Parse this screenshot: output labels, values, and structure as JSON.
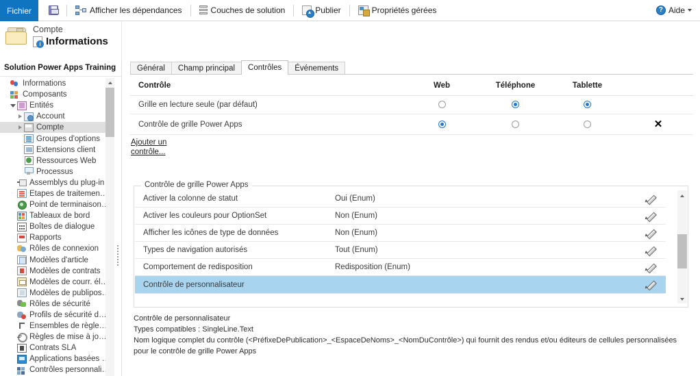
{
  "ribbon": {
    "file_tab": "Fichier",
    "items": [
      {
        "label": "",
        "icon": "save-icon",
        "name": "save-button"
      },
      {
        "label": "Afficher les dépendances",
        "icon": "dependencies-icon",
        "name": "show-dependencies-button"
      },
      {
        "label": "Couches de solution",
        "icon": "solution-layers-icon",
        "name": "solution-layers-button"
      },
      {
        "label": "Publier",
        "icon": "publish-icon",
        "name": "publish-button"
      },
      {
        "label": "Propriétés gérées",
        "icon": "managed-properties-icon",
        "name": "managed-properties-button"
      }
    ],
    "help_label": "Aide"
  },
  "header": {
    "entity_label": "Compte",
    "page_title": "Informations"
  },
  "sidebar": {
    "solution_title": "Solution Power Apps Training",
    "items": [
      {
        "label": "Informations",
        "icon": "balloons-icon",
        "indent": 0,
        "twist": "none",
        "selected": false
      },
      {
        "label": "Composants",
        "icon": "components-icon",
        "indent": 0,
        "twist": "none",
        "selected": false
      },
      {
        "label": "Entités",
        "icon": "entities-icon",
        "indent": 1,
        "twist": "open",
        "selected": false
      },
      {
        "label": "Account",
        "icon": "account-icon",
        "indent": 2,
        "twist": "closed",
        "selected": false
      },
      {
        "label": "Compte",
        "icon": "compte-icon",
        "indent": 2,
        "twist": "closed",
        "selected": true
      },
      {
        "label": "Groupes d'options",
        "icon": "option-sets-icon",
        "indent": 2,
        "twist": "none",
        "selected": false
      },
      {
        "label": "Extensions client",
        "icon": "client-extensions-icon",
        "indent": 2,
        "twist": "none",
        "selected": false
      },
      {
        "label": "Ressources Web",
        "icon": "web-resources-icon",
        "indent": 2,
        "twist": "none",
        "selected": false
      },
      {
        "label": "Processus",
        "icon": "processes-icon",
        "indent": 2,
        "twist": "none",
        "selected": false
      },
      {
        "label": "Assemblys du plug-in",
        "icon": "plugin-assemblies-icon",
        "indent": 1,
        "twist": "none",
        "selected": false
      },
      {
        "label": "Étapes de traitement d...",
        "icon": "sdk-steps-icon",
        "indent": 1,
        "twist": "none",
        "selected": false
      },
      {
        "label": "Point de terminaison d...",
        "icon": "service-endpoint-icon",
        "indent": 1,
        "twist": "none",
        "selected": false
      },
      {
        "label": "Tableaux de bord",
        "icon": "dashboards-icon",
        "indent": 1,
        "twist": "none",
        "selected": false
      },
      {
        "label": "Boîtes de dialogue",
        "icon": "dialogs-icon",
        "indent": 1,
        "twist": "none",
        "selected": false
      },
      {
        "label": "Rapports",
        "icon": "reports-icon",
        "indent": 1,
        "twist": "none",
        "selected": false
      },
      {
        "label": "Rôles de connexion",
        "icon": "connection-roles-icon",
        "indent": 1,
        "twist": "none",
        "selected": false
      },
      {
        "label": "Modèles d'article",
        "icon": "article-templates-icon",
        "indent": 1,
        "twist": "none",
        "selected": false
      },
      {
        "label": "Modèles de contrats",
        "icon": "contract-templates-icon",
        "indent": 1,
        "twist": "none",
        "selected": false
      },
      {
        "label": "Modèles de courr. électr.",
        "icon": "email-templates-icon",
        "indent": 1,
        "twist": "none",
        "selected": false
      },
      {
        "label": "Modèles de publiposta...",
        "icon": "mailmerge-templates-icon",
        "indent": 1,
        "twist": "none",
        "selected": false
      },
      {
        "label": "Rôles de sécurité",
        "icon": "security-roles-icon",
        "indent": 1,
        "twist": "none",
        "selected": false
      },
      {
        "label": "Profils de sécurité de c...",
        "icon": "field-security-icon",
        "indent": 1,
        "twist": "none",
        "selected": false
      },
      {
        "label": "Ensembles de règles d'...",
        "icon": "rule-sets-icon",
        "indent": 1,
        "twist": "none",
        "selected": false
      },
      {
        "label": "Règles de mise à jour e...",
        "icon": "update-rules-icon",
        "indent": 1,
        "twist": "none",
        "selected": false
      },
      {
        "label": "Contrats SLA",
        "icon": "sla-icon",
        "indent": 1,
        "twist": "none",
        "selected": false
      },
      {
        "label": "Applications basées su...",
        "icon": "model-driven-apps-icon",
        "indent": 1,
        "twist": "none",
        "selected": false
      },
      {
        "label": "Contrôles personnalisés",
        "icon": "custom-controls-icon",
        "indent": 1,
        "twist": "none",
        "selected": false
      }
    ]
  },
  "main": {
    "tabs": [
      {
        "label": "Général",
        "active": false
      },
      {
        "label": "Champ principal",
        "active": false
      },
      {
        "label": "Contrôles",
        "active": true
      },
      {
        "label": "Événements",
        "active": false
      }
    ],
    "controls_table": {
      "headers": [
        "Contrôle",
        "Web",
        "Téléphone",
        "Tablette",
        ""
      ],
      "rows": [
        {
          "name": "Grille en lecture seule (par défaut)",
          "web": false,
          "phone": true,
          "tablet": true,
          "removable": false,
          "remove_label": ""
        },
        {
          "name": "Contrôle de grille Power Apps",
          "web": true,
          "phone": false,
          "tablet": false,
          "removable": true,
          "remove_label": "✕"
        }
      ]
    },
    "add_control_link": "Ajouter un contrôle...",
    "properties_group": {
      "legend": "Contrôle de grille Power Apps",
      "rows": [
        {
          "name": "Activer la colonne de statut",
          "value": "Oui (Enum)",
          "selected": false
        },
        {
          "name": "Activer les couleurs pour OptionSet",
          "value": "Non (Enum)",
          "selected": false
        },
        {
          "name": "Afficher les icônes de type de données",
          "value": "Non (Enum)",
          "selected": false
        },
        {
          "name": "Types de navigation autorisés",
          "value": "Tout (Enum)",
          "selected": false
        },
        {
          "name": "Comportement de redisposition",
          "value": "Redisposition (Enum)",
          "selected": false
        },
        {
          "name": "Contrôle de personnalisateur",
          "value": "",
          "selected": true
        }
      ]
    },
    "description": {
      "line1": "Contrôle de personnalisateur",
      "line2": "Types compatibles : SingleLine.Text",
      "line3": "Nom logique complet du contrôle (<PréfixeDePublication>_<EspaceDeNoms>_<NomDuContrôle>) qui fournit des rendus et/ou éditeurs de cellules personnalisées pour le contrôle de grille Power Apps"
    }
  },
  "colors": {
    "accent": "#1075c1",
    "radio_on": "#1f78d1",
    "row_selected": "#a8d4f0",
    "tree_selected": "#dfdfdf"
  }
}
